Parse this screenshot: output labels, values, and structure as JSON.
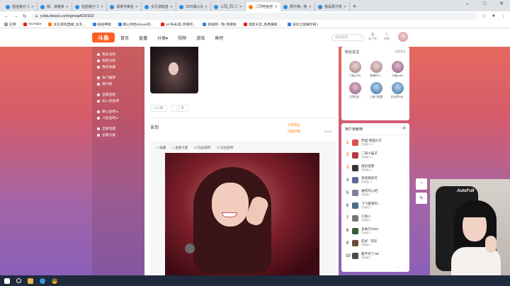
{
  "browser": {
    "tabs": [
      {
        "label": "拍拍第万 华爆神城",
        "icon": "blue"
      },
      {
        "label": "锁、锁链锁版ulim",
        "icon": "blue"
      },
      {
        "label": "拍拍第万 华爆神城",
        "icon": "blue"
      },
      {
        "label": "请搜寻索亚斯特",
        "icon": "blue"
      },
      {
        "label": "女孔游戏直播_女",
        "icon": "blue"
      },
      {
        "label": "2020最火最佳手",
        "icon": "blue"
      },
      {
        "label": "三同_同二同直播",
        "icon": "blue"
      },
      {
        "label": "二同吧鱼吧_斗鱼",
        "icon": "orange"
      },
      {
        "label": "那方喵 - 搜索结",
        "icon": "blue"
      },
      {
        "label": "我是那方喵的小",
        "icon": "blue"
      }
    ],
    "active_tab_index": 7,
    "new_tab": "+",
    "window_controls": [
      "–",
      "□",
      "✕"
    ],
    "nav": {
      "back": "←",
      "forward": "→",
      "reload": "↻"
    },
    "url": "yuba.douyu.com/group/620332",
    "right_icons": [
      "☆",
      "●",
      "⋮"
    ],
    "bookmarks": [
      {
        "label": "应用",
        "icon": "g"
      },
      {
        "label": "YouTube",
        "icon": "r"
      },
      {
        "label": "女孔游戏直播_女孔...",
        "icon": "o"
      },
      {
        "label": "拍拍神城",
        "icon": "b"
      },
      {
        "label": "那心特色/Miyuki的...",
        "icon": "b"
      },
      {
        "label": "(47条未读) 阿要的...",
        "icon": "r"
      },
      {
        "label": "搜狐网 - 我! 我要收",
        "icon": "b"
      },
      {
        "label": "电影天堂_免费最新...",
        "icon": "r"
      },
      {
        "label": "该诉之星破印阔 (",
        "icon": "b"
      }
    ]
  },
  "site": {
    "logo": "斗鱼",
    "nav": [
      "首页",
      "直播",
      "分类▾",
      "视频",
      "游戏",
      "鱼吧"
    ],
    "search_placeholder": "搜索鱼吧",
    "search_icon": "⌕",
    "header_icons": [
      {
        "icon": "◎",
        "label": "发个鱼"
      },
      {
        "icon": "♧",
        "label": "消息"
      }
    ]
  },
  "sidebar": {
    "groups": [
      [
        "我关注的",
        "我赞过的",
        "我的收藏"
      ],
      [
        "热门推荐",
        "排行榜"
      ],
      [
        "全部鱼吧",
        "加入的鱼吧"
      ],
      [
        "那心鱼吧 ▸",
        "斗鱼鱼吧 ▸"
      ],
      [
        "全部话题",
        "全部分类"
      ]
    ]
  },
  "post": {
    "likes": "21",
    "comments": "3",
    "author": "苦到",
    "tagline": "-",
    "right_tags": [
      "只有吧主",
      "已经点赞"
    ],
    "time": "09:00",
    "toolbar": [
      "收藏",
      "查看大图",
      "向左旋转",
      "向右旋转"
    ]
  },
  "fans": {
    "title": "粉丝关注",
    "more": "查看更多",
    "items": [
      "二喵(小叶)",
      "老喵的小...",
      "小喵smile",
      "三同的迷...",
      "三喵小星星",
      "长长的PNL"
    ]
  },
  "rank": {
    "title": "用户贡献榜",
    "icons": "⋯ ▣",
    "items": [
      {
        "rank": "1",
        "name": "苏喵 秀喵贝贝",
        "sub": "贡献值 24"
      },
      {
        "rank": "2",
        "name": "二同小猫子",
        "sub": "贡献值 14"
      },
      {
        "rank": "3",
        "name": "倍封诺建",
        "sub": "贡献值 12"
      },
      {
        "rank": "4",
        "name": "有哈我的可",
        "sub": "贡献值 10"
      },
      {
        "rank": "5",
        "name": "难得开心吧",
        "sub": "贡献值 7"
      },
      {
        "rank": "6",
        "name": "飞飞雷克利...",
        "sub": "贡献值 5"
      },
      {
        "rank": "7",
        "name": "小张人",
        "sub": "贡献值 5"
      },
      {
        "rank": "8",
        "name": "多纳万2000",
        "sub": "贡献值 3"
      },
      {
        "rank": "9",
        "name": "在好 - 羽天",
        "sub": "贡献值 3"
      },
      {
        "rank": "10",
        "name": "最不开了JW",
        "sub": "贡献值 2"
      }
    ],
    "pager": "‹   ›"
  },
  "float_buttons": [
    "⌃",
    "✎"
  ],
  "webcam": {
    "chair_logo": "AutoFull"
  }
}
